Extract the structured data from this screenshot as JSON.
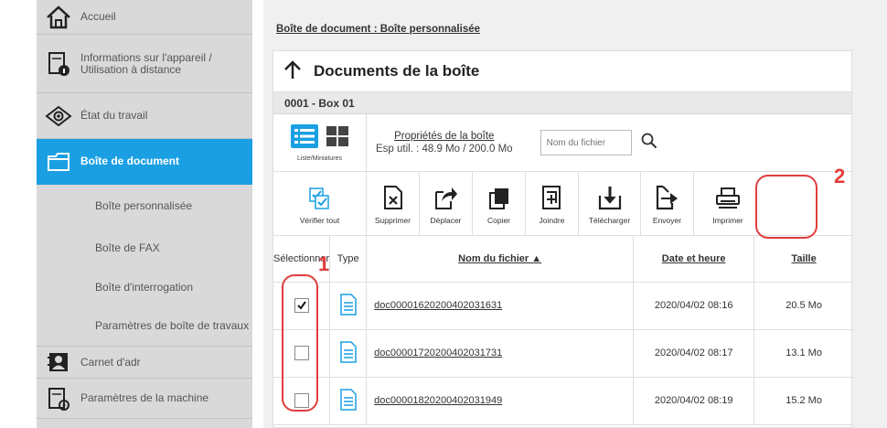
{
  "sidebar": {
    "items": [
      {
        "label": "Accueil",
        "icon": "home-icon"
      },
      {
        "label": "Informations sur l'appareil / Utilisation à distance",
        "icon": "device-info-icon"
      },
      {
        "label": "État du travail",
        "icon": "eye-icon"
      },
      {
        "label": "Boîte de document",
        "icon": "folder-icon",
        "active": true
      },
      {
        "label": "Carnet d'adr",
        "icon": "address-book-icon"
      },
      {
        "label": "Paramètres de la machine",
        "icon": "machine-settings-icon"
      }
    ],
    "subitems": [
      {
        "label": "Boîte personnalisée"
      },
      {
        "label": "Boîte de FAX"
      },
      {
        "label": "Boîte d'interrogation"
      },
      {
        "label": "Paramètres de boîte de travaux"
      }
    ]
  },
  "breadcrumb": "Boîte de document : Boîte personnalisée",
  "header": {
    "title": "Documents de la boîte",
    "back_icon": "arrow-up-icon"
  },
  "box": {
    "label": "0001 - Box 01"
  },
  "view": {
    "caption": "Liste/Miniatures"
  },
  "properties": {
    "link": "Propriétés de la boîte",
    "usage": "Esp util. : 48.9 Mo / 200.0 Mo"
  },
  "search": {
    "placeholder": "Nom du fichier"
  },
  "toolbar": {
    "verify_all": "Vérifier tout",
    "delete": "Supprimer",
    "move": "Déplacer",
    "copy": "Copier",
    "join": "Joindre",
    "download": "Télécharger",
    "send": "Envoyer",
    "print": "Imprimer"
  },
  "table": {
    "headers": {
      "select": "Sélectionner",
      "type": "Type",
      "name": "Nom du fichier ▲",
      "date": "Date et heure",
      "size": "Taille"
    },
    "rows": [
      {
        "checked": true,
        "name": "doc00001620200402031631",
        "date": "2020/04/02 08:16",
        "size": "20.5 Mo"
      },
      {
        "checked": false,
        "name": "doc00001720200402031731",
        "date": "2020/04/02 08:17",
        "size": "13.1 Mo"
      },
      {
        "checked": false,
        "name": "doc00001820200402031949",
        "date": "2020/04/02 08:19",
        "size": "15.2 Mo"
      }
    ]
  },
  "annotations": {
    "step1": "1",
    "step2": "2"
  },
  "colors": {
    "accent": "#1a9fe3",
    "annotation": "#e23c3c",
    "sidebar_bg": "#d9d9d9"
  }
}
